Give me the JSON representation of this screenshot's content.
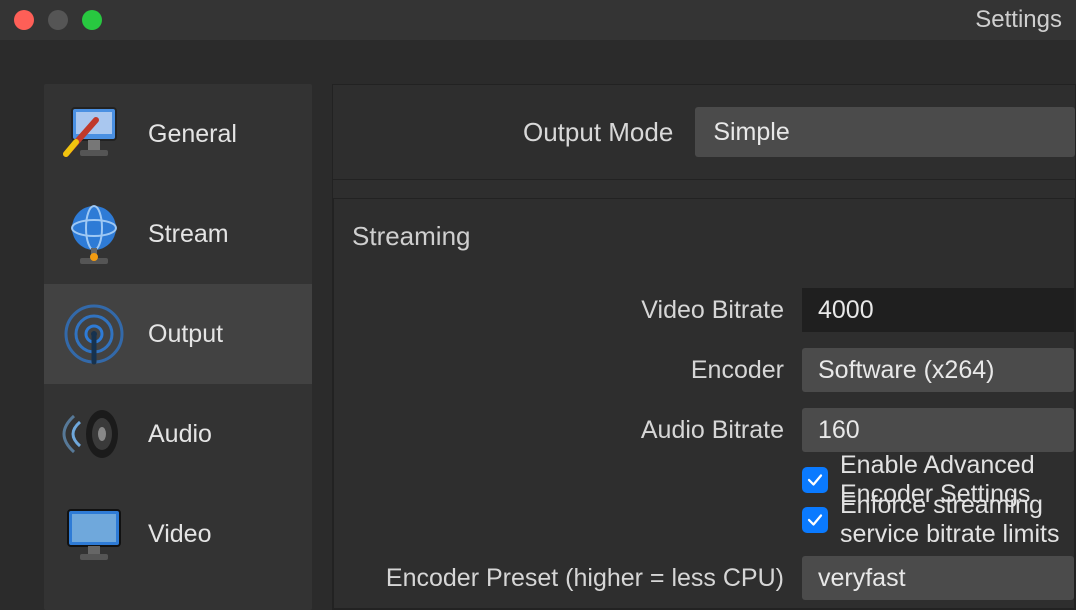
{
  "window": {
    "title": "Settings"
  },
  "sidebar": {
    "items": [
      {
        "label": "General"
      },
      {
        "label": "Stream"
      },
      {
        "label": "Output"
      },
      {
        "label": "Audio"
      },
      {
        "label": "Video"
      }
    ],
    "selected_index": 2
  },
  "output_mode": {
    "label": "Output Mode",
    "value": "Simple"
  },
  "streaming": {
    "section_title": "Streaming",
    "video_bitrate": {
      "label": "Video Bitrate",
      "value": "4000"
    },
    "encoder": {
      "label": "Encoder",
      "value": "Software (x264)"
    },
    "audio_bitrate": {
      "label": "Audio Bitrate",
      "value": "160"
    },
    "enable_advanced": {
      "label": "Enable Advanced Encoder Settings",
      "checked": true
    },
    "enforce_streaming": {
      "label": "Enforce streaming service bitrate limits",
      "checked": true
    },
    "encoder_preset": {
      "label": "Encoder Preset (higher = less CPU)",
      "value": "veryfast"
    }
  }
}
